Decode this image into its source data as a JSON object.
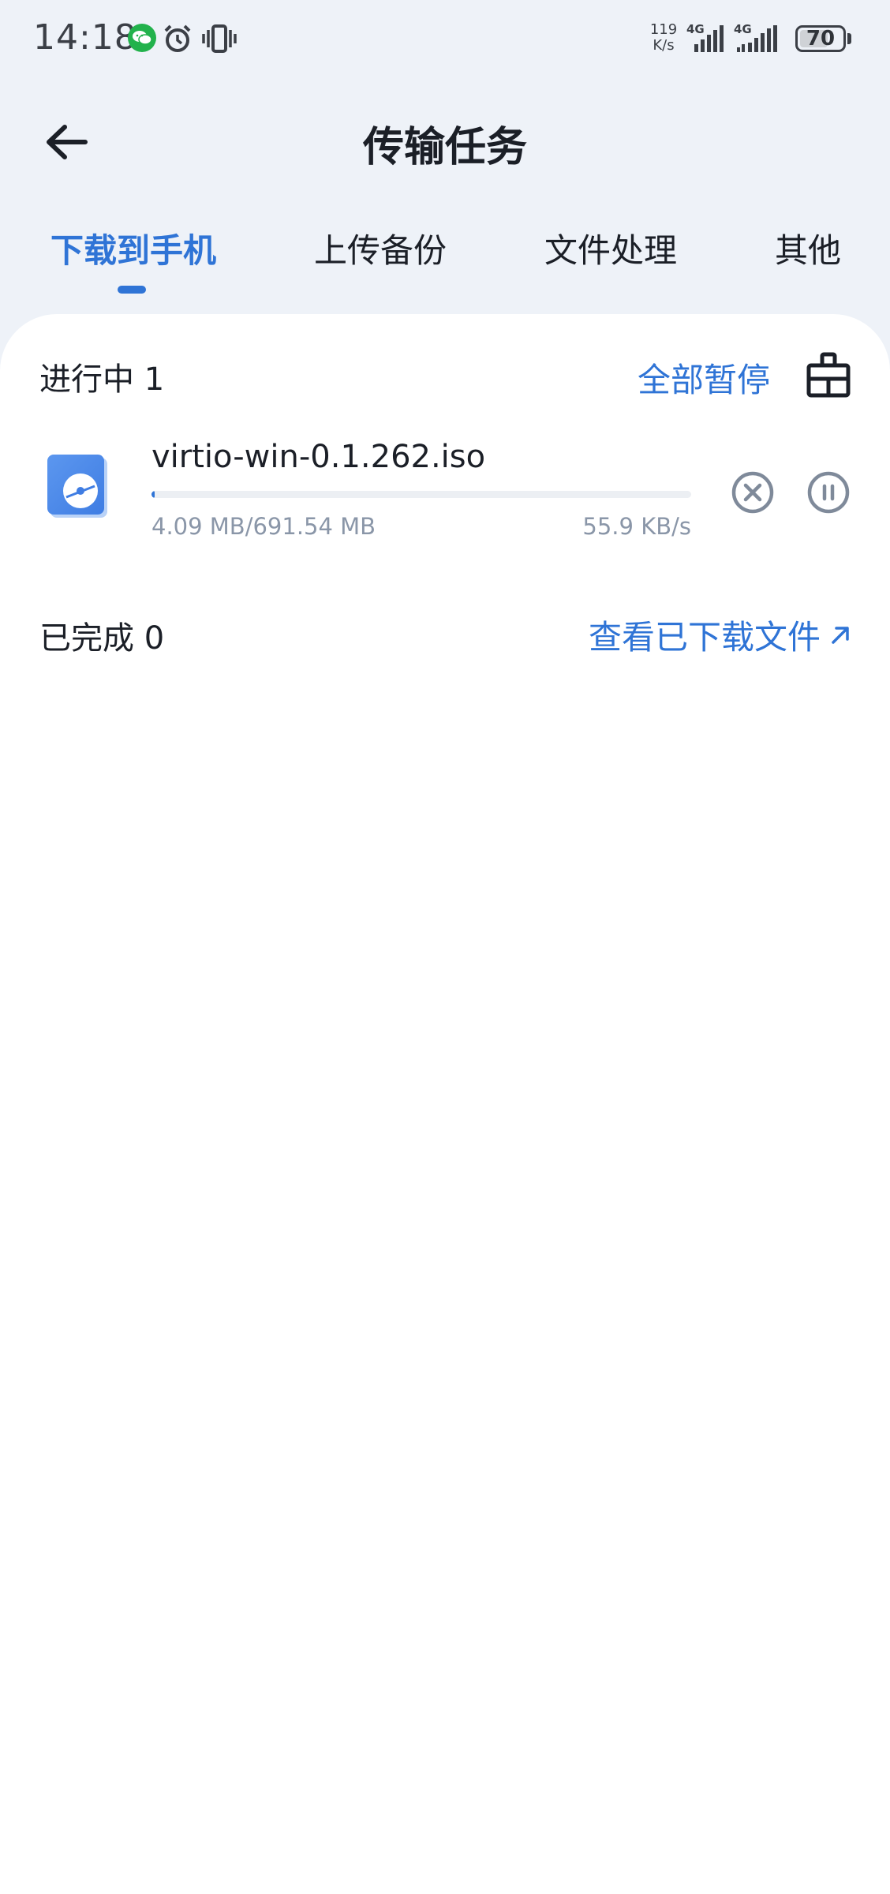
{
  "status_bar": {
    "time": "14:18",
    "net_speed_value": "119",
    "net_speed_unit": "K/s",
    "signal_1_label": "4G",
    "signal_2_label": "4G",
    "battery_level": "70",
    "battery_fraction": 0.7,
    "icons": [
      "wechat-icon",
      "alarm-icon",
      "vibrate-icon",
      "signal-icon",
      "battery-icon"
    ]
  },
  "header": {
    "title": "传输任务",
    "back_icon": "arrow-left-icon"
  },
  "tabs": [
    {
      "label": "下载到手机",
      "active": true
    },
    {
      "label": "上传备份",
      "active": false
    },
    {
      "label": "文件处理",
      "active": false
    },
    {
      "label": "其他",
      "active": false
    }
  ],
  "in_progress": {
    "title": "进行中 1",
    "pause_all_label": "全部暂停",
    "clear_icon": "broom-icon",
    "tasks": [
      {
        "file_name": "virtio-win-0.1.262.iso",
        "size_text": "4.09 MB/691.54 MB",
        "speed_text": "55.9 KB/s",
        "progress_fraction": 0.006,
        "file_icon": "disc-image-icon"
      }
    ]
  },
  "completed": {
    "title": "已完成 0",
    "view_downloaded_label": "查看已下载文件",
    "arrow_icon": "arrow-up-right-icon"
  },
  "colors": {
    "accent": "#2f74d6",
    "background": "#eef2f8",
    "card": "#ffffff",
    "secondary_text": "#8a96a8"
  }
}
